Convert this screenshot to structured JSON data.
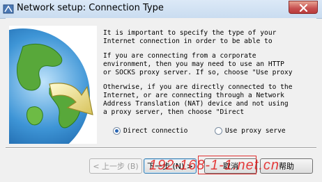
{
  "window": {
    "title": "Network setup: Connection Type"
  },
  "body_text": {
    "para1": [
      "It is important to specify the type of your",
      "Internet connection in order to be able to"
    ],
    "para2": [
      "If you are connecting from a corporate",
      "environment, then you may need to use an HTTP",
      "or SOCKS proxy server. If so, choose \"Use proxy"
    ],
    "para3": [
      "Otherwise, if you are directly connected to the",
      "Internet, or are connecting through a Network",
      "Address Translation (NAT) device and not using",
      "a proxy server, then choose \"Direct"
    ]
  },
  "options": [
    {
      "label": "Direct connectio",
      "selected": true
    },
    {
      "label": "Use proxy serve",
      "selected": false
    }
  ],
  "buttons": {
    "back": "< 上一步 (B)",
    "next": "下一步 (N) >",
    "cancel": "取消",
    "help": "帮助"
  },
  "watermark": "192-168-1-1.net.cn",
  "colors": {
    "radio_selected": "#2a66b3",
    "watermark": "#e21d1d"
  }
}
